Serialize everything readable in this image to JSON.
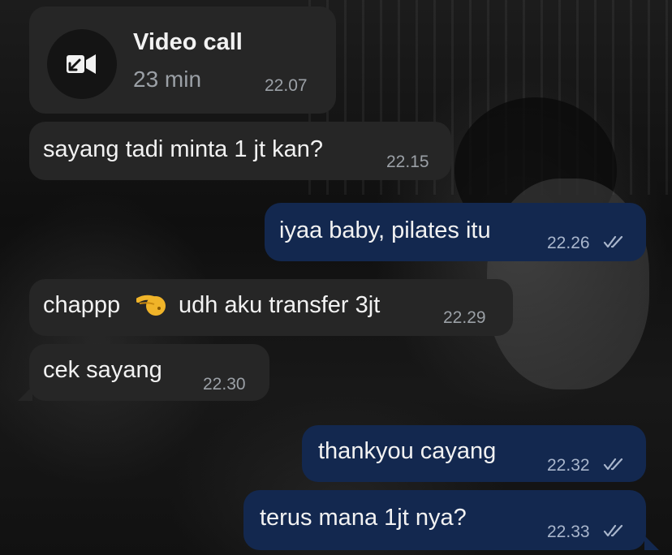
{
  "chat": {
    "call": {
      "title": "Video call",
      "duration": "23 min",
      "time": "22.07",
      "icon": "video-call-incoming-icon"
    },
    "messages": [
      {
        "direction": "incoming",
        "text": "sayang tadi minta 1 jt kan?",
        "time": "22.15"
      },
      {
        "direction": "outgoing",
        "text": "iyaa baby, pilates itu",
        "time": "22.26",
        "status": "read"
      },
      {
        "direction": "incoming",
        "text_before": "chappp",
        "emoji": "pinching-hand-emoji",
        "text_after": "udh aku transfer 3jt",
        "time": "22.29"
      },
      {
        "direction": "incoming",
        "text": "cek sayang",
        "time": "22.30"
      },
      {
        "direction": "outgoing",
        "text": "thankyou cayang",
        "time": "22.32",
        "status": "read"
      },
      {
        "direction": "outgoing",
        "text": "terus mana 1jt nya?",
        "time": "22.33",
        "status": "read"
      }
    ]
  },
  "colors": {
    "incoming_bubble": "#262626",
    "outgoing_bubble": "#13284f",
    "text": "#f2f2f2",
    "timestamp": "#9ba0a6"
  }
}
